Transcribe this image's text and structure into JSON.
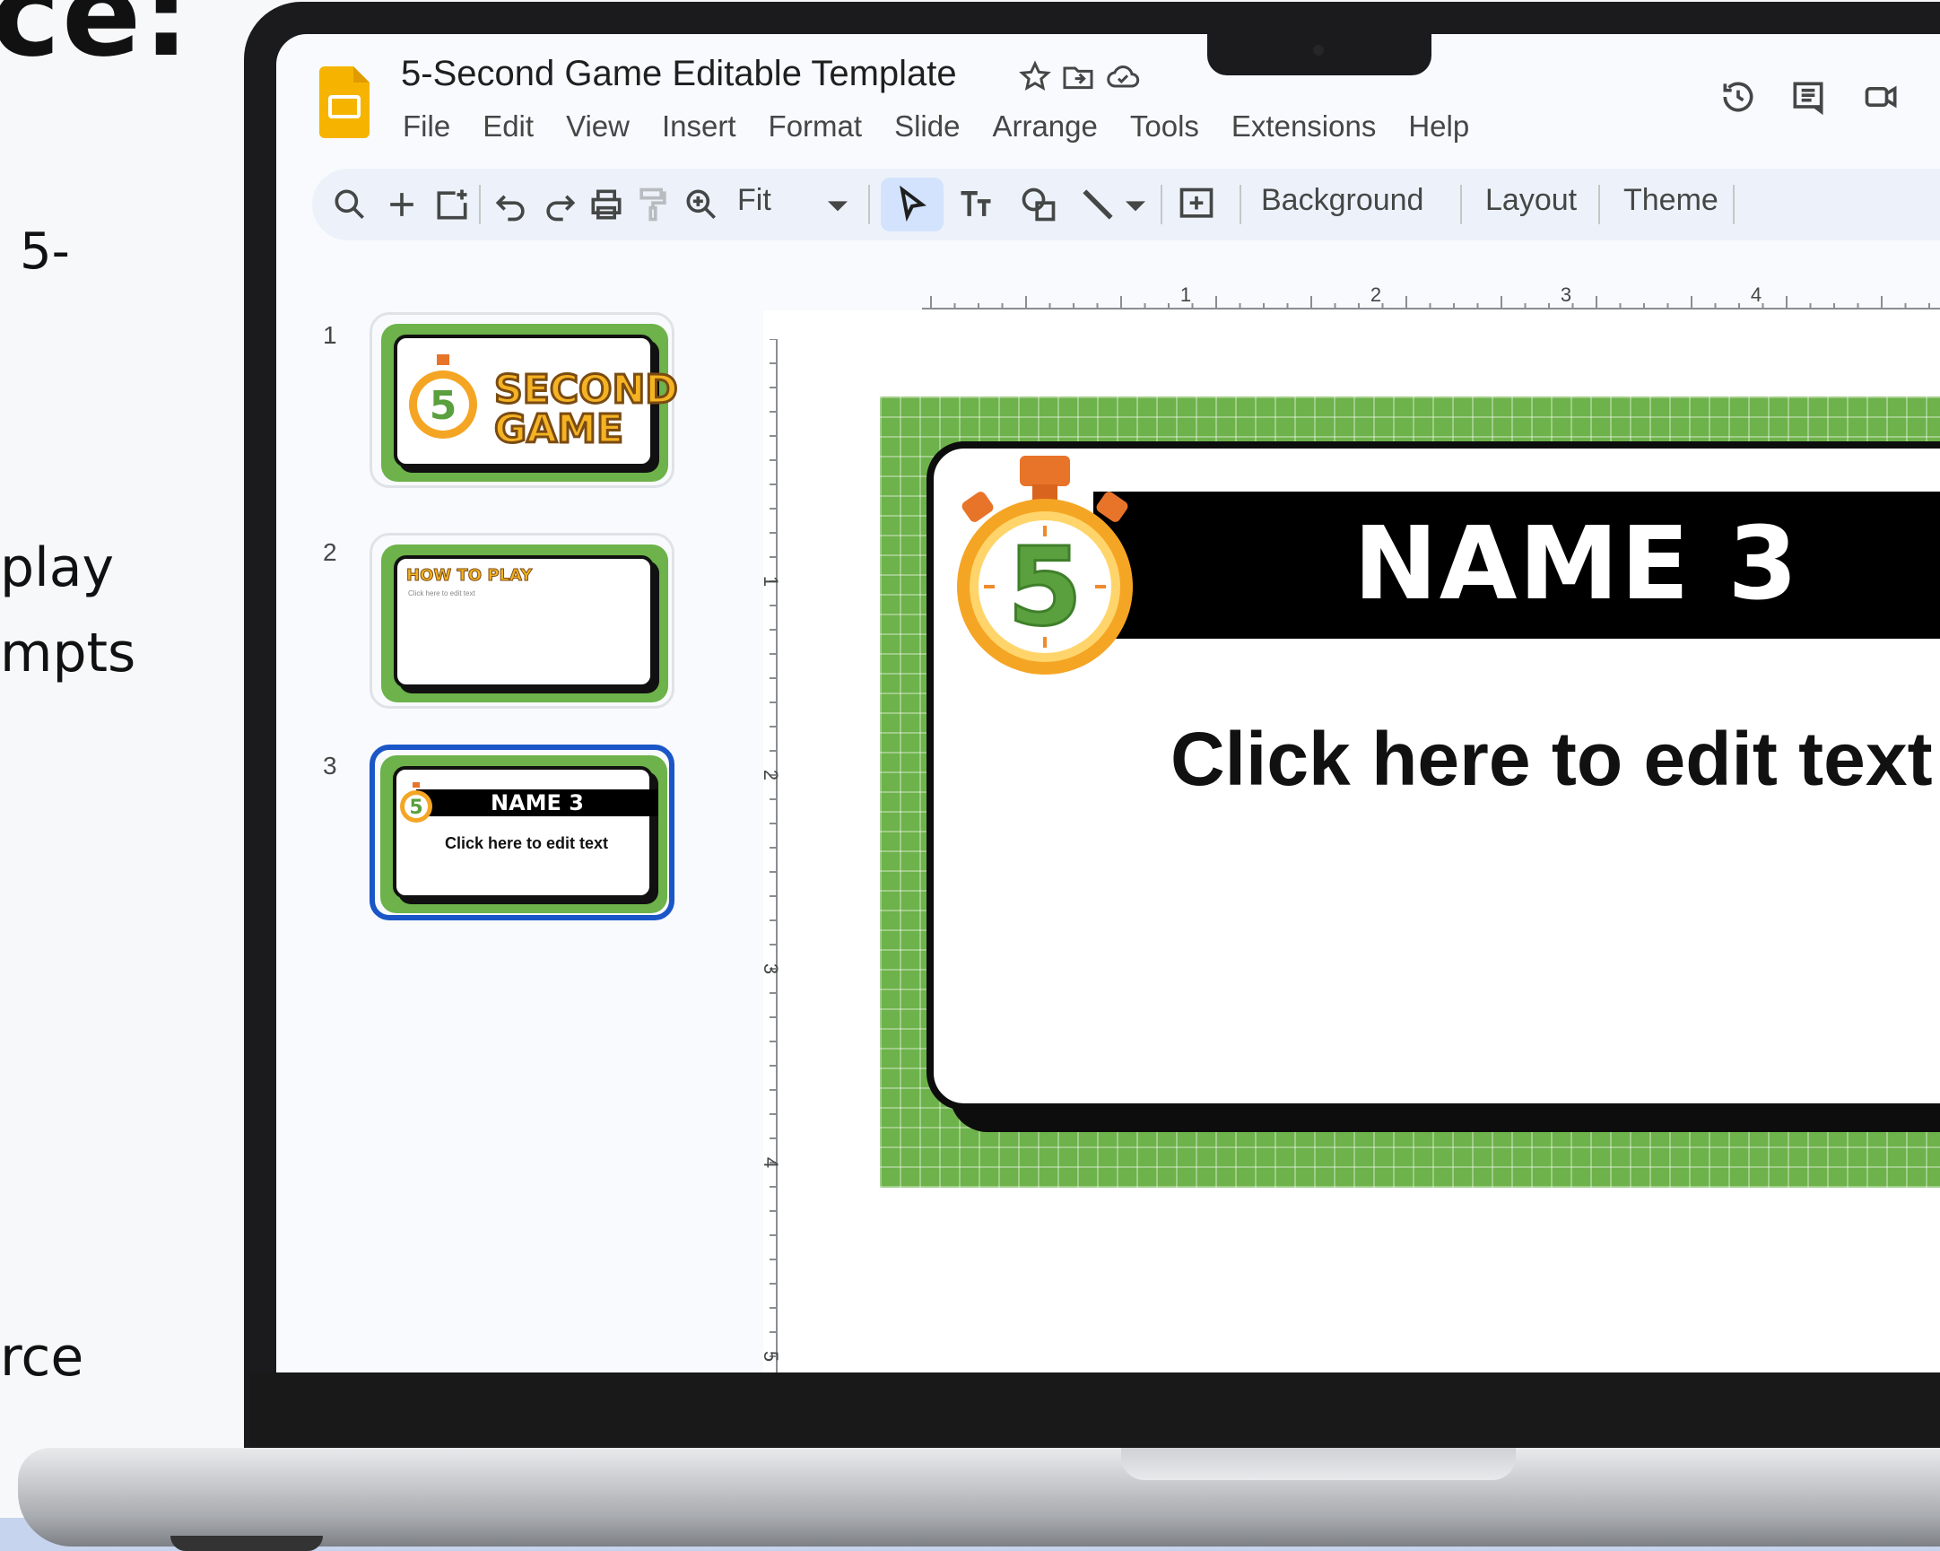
{
  "promo": {
    "top_fragment": "ce:",
    "line_1": "5-",
    "line_2": "play",
    "line_3": "mpts",
    "line_4": "rce"
  },
  "app": {
    "doc_title": "5-Second Game Editable Template",
    "menu": [
      "File",
      "Edit",
      "View",
      "Insert",
      "Format",
      "Slide",
      "Arrange",
      "Tools",
      "Extensions",
      "Help"
    ],
    "icons": [
      "star-icon",
      "move-to-folder-icon",
      "cloud-saved-icon",
      "version-history-icon",
      "comments-icon",
      "meet-icon"
    ]
  },
  "toolbar": {
    "zoom_label": "Fit",
    "background_label": "Background",
    "layout_label": "Layout",
    "theme_label": "Theme"
  },
  "ruler": {
    "h_ticks": [
      "1",
      "2",
      "3",
      "4"
    ],
    "v_ticks": [
      "1",
      "2",
      "3",
      "4",
      "5"
    ]
  },
  "filmstrip": {
    "slides": [
      {
        "number": "1",
        "title_line1": "SECOND",
        "title_line2": "GAME",
        "badge": "5"
      },
      {
        "number": "2",
        "title": "HOW TO PLAY",
        "subtitle": "Click here to edit text"
      },
      {
        "number": "3",
        "name": "NAME 3",
        "text": "Click here to edit text",
        "badge": "5"
      }
    ]
  },
  "slide": {
    "name": "NAME 3",
    "body": "Click here to edit text",
    "badge": "5"
  },
  "colors": {
    "accent_green": "#6db24a",
    "selection_blue": "#1a56c7",
    "stopwatch_orange": "#f5a524"
  }
}
